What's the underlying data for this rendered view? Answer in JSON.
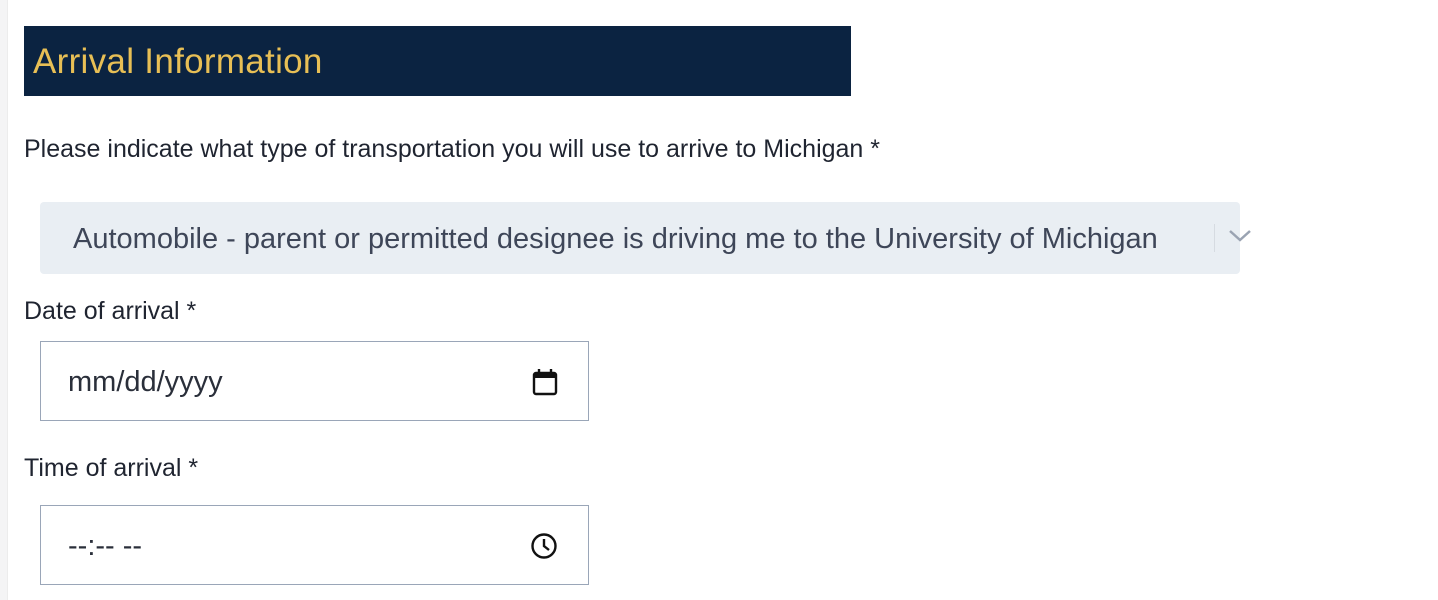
{
  "section": {
    "title": "Arrival Information"
  },
  "transportation": {
    "label": "Please indicate what type of transportation you will use to arrive to Michigan *",
    "selected": "Automobile - parent or permitted designee is driving me to the University of Michigan"
  },
  "date": {
    "label": "Date of arrival *",
    "placeholder": "mm/dd/yyyy"
  },
  "time": {
    "label": "Time of arrival *",
    "placeholder": "--:-- --"
  }
}
